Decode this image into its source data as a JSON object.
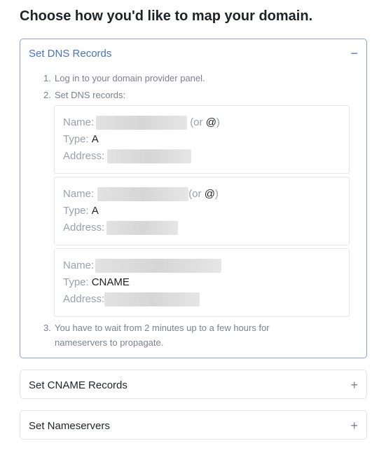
{
  "page": {
    "title": "Choose how you'd like to map your domain."
  },
  "dns_records": {
    "header": "Set DNS Records",
    "toggle": "−",
    "steps": [
      {
        "number": "1.",
        "text": "Log in to your domain provider panel."
      },
      {
        "number": "2.",
        "text": "Set DNS records:"
      },
      {
        "number": "3.",
        "text": "You have to wait from 2 minutes up to a few hours for nameservers to propagate."
      }
    ],
    "records": [
      {
        "name_label": "Name:",
        "name_suffix_open": "(or ",
        "name_suffix_at": "@",
        "name_suffix_close": ")",
        "type_label": "Type:",
        "type_value": "A",
        "address_label": "Address:"
      },
      {
        "name_label": "Name:",
        "name_suffix_open": "(or ",
        "name_suffix_at": "@",
        "name_suffix_close": ")",
        "type_label": "Type:",
        "type_value": "A",
        "address_label": "Address:"
      },
      {
        "name_label": "Name:",
        "type_label": "Type:",
        "type_value": "CNAME",
        "address_label": "Address:"
      }
    ]
  },
  "cname_records": {
    "header": "Set CNAME Records",
    "toggle": "+"
  },
  "nameservers": {
    "header": "Set Nameservers",
    "toggle": "+"
  }
}
